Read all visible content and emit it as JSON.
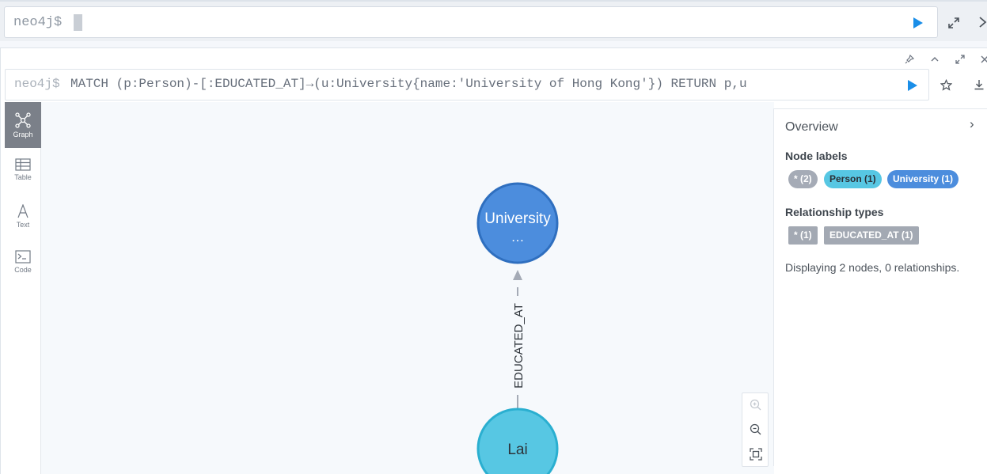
{
  "top_editor": {
    "prompt": "neo4j$",
    "run_icon": "play-icon",
    "expand_icon": "expand-icon",
    "close_icon": "close-icon"
  },
  "frame": {
    "controls": [
      "pin-icon",
      "collapse-icon",
      "fullscreen-icon",
      "close-icon"
    ],
    "prompt": "neo4j$",
    "query": "MATCH (p:Person)-[:EDUCATED_AT]→(u:University{name:'University of Hong Kong'}) RETURN p,u",
    "actions": [
      "play-icon",
      "star-icon",
      "download-icon"
    ]
  },
  "side_nav": [
    {
      "label": "Graph",
      "icon": "graph-icon",
      "active": true
    },
    {
      "label": "Table",
      "icon": "table-icon",
      "active": false
    },
    {
      "label": "Text",
      "icon": "text-icon",
      "active": false
    },
    {
      "label": "Code",
      "icon": "code-icon",
      "active": false
    }
  ],
  "graph": {
    "nodes": [
      {
        "label": "University",
        "sublabel": "…",
        "kind": "University",
        "color": "#4c8ddd",
        "border": "#2f6fbf"
      },
      {
        "label": "Lai",
        "sublabel": "",
        "kind": "Person",
        "color": "#57c7e3",
        "border": "#2aafd0"
      }
    ],
    "relationship": {
      "type": "EDUCATED_AT",
      "color": "#a5abb6"
    }
  },
  "zoom": [
    "zoom-in-icon",
    "zoom-out-icon",
    "fit-icon"
  ],
  "overview": {
    "title": "Overview",
    "node_labels_heading": "Node labels",
    "node_labels": [
      {
        "text": "* (2)",
        "bg": "#a5abb6",
        "fg": "#ffffff"
      },
      {
        "text": "Person (1)",
        "bg": "#57c7e3",
        "fg": "#2a2f36"
      },
      {
        "text": "University (1)",
        "bg": "#4c8ddd",
        "fg": "#ffffff"
      }
    ],
    "relationship_types_heading": "Relationship types",
    "relationship_types": [
      {
        "text": "* (1)"
      },
      {
        "text": "EDUCATED_AT (1)"
      }
    ],
    "status": "Displaying 2 nodes, 0 relationships."
  }
}
